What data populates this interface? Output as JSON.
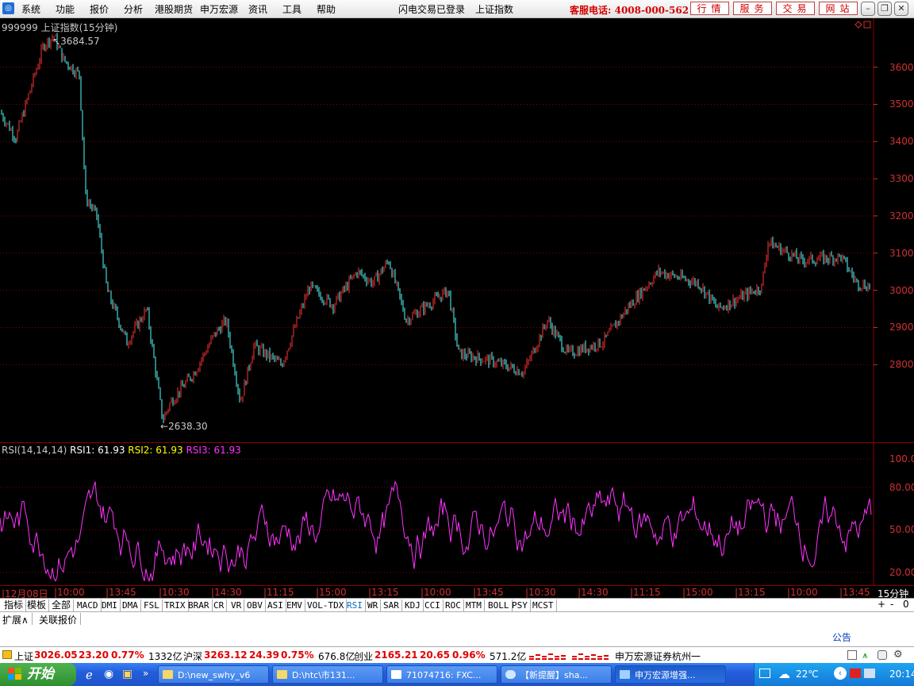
{
  "menu": [
    "系统",
    "功能",
    "报价",
    "分析",
    "港股期货",
    "申万宏源",
    "资讯",
    "工具",
    "帮助"
  ],
  "header": {
    "login_status": "闪电交易已登录",
    "index_name": "上证指数",
    "hotline": "客服电话: 4008-000-562",
    "buttons": [
      "行情",
      "服务",
      "交易",
      "网站"
    ]
  },
  "price_chart": {
    "title": "999999 上证指数(15分钟)",
    "high_label": "3684.57",
    "low_label": "2638.30",
    "y_ticks": [
      "3600",
      "3500",
      "3400",
      "3300",
      "3200",
      "3100",
      "3000",
      "2900",
      "2800"
    ]
  },
  "rsi_chart": {
    "title": "RSI(14,14,14)",
    "rsi1": "RSI1: 61.93",
    "rsi2": "RSI2: 61.93",
    "rsi3": "RSI3: 61.93",
    "y_ticks": [
      "100.00",
      "80.00",
      "50.00",
      "20.00"
    ]
  },
  "x_axis": [
    "12月08日",
    "10:00",
    "13:45",
    "10:30",
    "14:30",
    "11:15",
    "15:00",
    "13:15",
    "10:00",
    "13:45",
    "10:30",
    "14:30",
    "11:15",
    "15:00",
    "13:15",
    "10:00",
    "13:45"
  ],
  "period_label": "15分钟",
  "pager": [
    "+",
    "-",
    "0"
  ],
  "indicator_tabs": [
    "指标",
    "模板",
    "全部",
    "MACD",
    "DMI",
    "DMA",
    "FSL",
    "TRIX",
    "BRAR",
    "CR",
    "VR",
    "OBV",
    "ASI",
    "EMV",
    "VOL-TDX",
    "RSI",
    "WR",
    "SAR",
    "KDJ",
    "CCI",
    "ROC",
    "MTM",
    "BOLL",
    "PSY",
    "MCST"
  ],
  "active_tab": "RSI",
  "ext_tabs": [
    "扩展∧",
    "关联报价"
  ],
  "notice_label": "公告",
  "status": {
    "sh_label": "上证",
    "sh_value": "3026.05",
    "sh_change": "23.20",
    "sh_pct": "0.77%",
    "sh_amount": "1332亿",
    "hs_label": "沪深",
    "hs_value": "3263.12",
    "hs_change": "24.39",
    "hs_pct": "0.75%",
    "hs_amount": "676.8亿",
    "cy_label": "创业",
    "cy_value": "2165.21",
    "cy_change": "20.65",
    "cy_pct": "0.96%",
    "cy_amount": "571.2亿",
    "broker": "申万宏源证券杭州一"
  },
  "taskbar": {
    "start": "开始",
    "tasks": [
      "D:\\new_swhy_v6",
      "D:\\htc\\市131...",
      "71074716: FXC...",
      "【新提醒】sha...",
      "申万宏源增强..."
    ],
    "weather": "22℃",
    "clock": "20:14"
  },
  "colors": {
    "up": "#ff3333",
    "down": "#54ffff",
    "rsi": "#ff33ff",
    "grid": "#8b0000",
    "axis": "#d03030"
  }
}
